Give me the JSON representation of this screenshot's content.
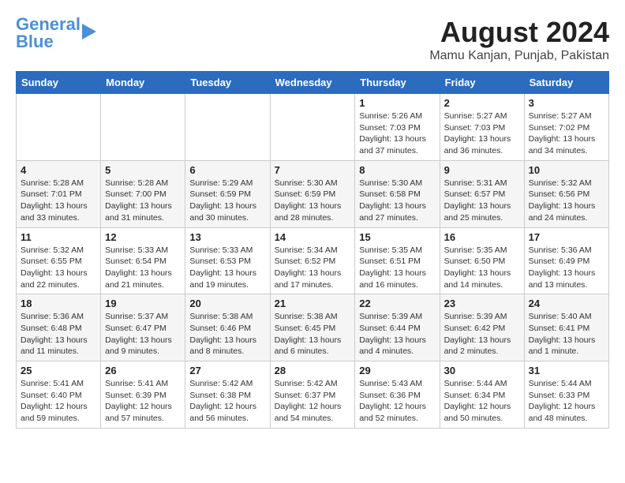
{
  "header": {
    "logo_general": "General",
    "logo_blue": "Blue",
    "month_year": "August 2024",
    "location": "Mamu Kanjan, Punjab, Pakistan"
  },
  "weekdays": [
    "Sunday",
    "Monday",
    "Tuesday",
    "Wednesday",
    "Thursday",
    "Friday",
    "Saturday"
  ],
  "weeks": [
    [
      {
        "day": "",
        "info": ""
      },
      {
        "day": "",
        "info": ""
      },
      {
        "day": "",
        "info": ""
      },
      {
        "day": "",
        "info": ""
      },
      {
        "day": "1",
        "info": "Sunrise: 5:26 AM\nSunset: 7:03 PM\nDaylight: 13 hours\nand 37 minutes."
      },
      {
        "day": "2",
        "info": "Sunrise: 5:27 AM\nSunset: 7:03 PM\nDaylight: 13 hours\nand 36 minutes."
      },
      {
        "day": "3",
        "info": "Sunrise: 5:27 AM\nSunset: 7:02 PM\nDaylight: 13 hours\nand 34 minutes."
      }
    ],
    [
      {
        "day": "4",
        "info": "Sunrise: 5:28 AM\nSunset: 7:01 PM\nDaylight: 13 hours\nand 33 minutes."
      },
      {
        "day": "5",
        "info": "Sunrise: 5:28 AM\nSunset: 7:00 PM\nDaylight: 13 hours\nand 31 minutes."
      },
      {
        "day": "6",
        "info": "Sunrise: 5:29 AM\nSunset: 6:59 PM\nDaylight: 13 hours\nand 30 minutes."
      },
      {
        "day": "7",
        "info": "Sunrise: 5:30 AM\nSunset: 6:59 PM\nDaylight: 13 hours\nand 28 minutes."
      },
      {
        "day": "8",
        "info": "Sunrise: 5:30 AM\nSunset: 6:58 PM\nDaylight: 13 hours\nand 27 minutes."
      },
      {
        "day": "9",
        "info": "Sunrise: 5:31 AM\nSunset: 6:57 PM\nDaylight: 13 hours\nand 25 minutes."
      },
      {
        "day": "10",
        "info": "Sunrise: 5:32 AM\nSunset: 6:56 PM\nDaylight: 13 hours\nand 24 minutes."
      }
    ],
    [
      {
        "day": "11",
        "info": "Sunrise: 5:32 AM\nSunset: 6:55 PM\nDaylight: 13 hours\nand 22 minutes."
      },
      {
        "day": "12",
        "info": "Sunrise: 5:33 AM\nSunset: 6:54 PM\nDaylight: 13 hours\nand 21 minutes."
      },
      {
        "day": "13",
        "info": "Sunrise: 5:33 AM\nSunset: 6:53 PM\nDaylight: 13 hours\nand 19 minutes."
      },
      {
        "day": "14",
        "info": "Sunrise: 5:34 AM\nSunset: 6:52 PM\nDaylight: 13 hours\nand 17 minutes."
      },
      {
        "day": "15",
        "info": "Sunrise: 5:35 AM\nSunset: 6:51 PM\nDaylight: 13 hours\nand 16 minutes."
      },
      {
        "day": "16",
        "info": "Sunrise: 5:35 AM\nSunset: 6:50 PM\nDaylight: 13 hours\nand 14 minutes."
      },
      {
        "day": "17",
        "info": "Sunrise: 5:36 AM\nSunset: 6:49 PM\nDaylight: 13 hours\nand 13 minutes."
      }
    ],
    [
      {
        "day": "18",
        "info": "Sunrise: 5:36 AM\nSunset: 6:48 PM\nDaylight: 13 hours\nand 11 minutes."
      },
      {
        "day": "19",
        "info": "Sunrise: 5:37 AM\nSunset: 6:47 PM\nDaylight: 13 hours\nand 9 minutes."
      },
      {
        "day": "20",
        "info": "Sunrise: 5:38 AM\nSunset: 6:46 PM\nDaylight: 13 hours\nand 8 minutes."
      },
      {
        "day": "21",
        "info": "Sunrise: 5:38 AM\nSunset: 6:45 PM\nDaylight: 13 hours\nand 6 minutes."
      },
      {
        "day": "22",
        "info": "Sunrise: 5:39 AM\nSunset: 6:44 PM\nDaylight: 13 hours\nand 4 minutes."
      },
      {
        "day": "23",
        "info": "Sunrise: 5:39 AM\nSunset: 6:42 PM\nDaylight: 13 hours\nand 2 minutes."
      },
      {
        "day": "24",
        "info": "Sunrise: 5:40 AM\nSunset: 6:41 PM\nDaylight: 13 hours\nand 1 minute."
      }
    ],
    [
      {
        "day": "25",
        "info": "Sunrise: 5:41 AM\nSunset: 6:40 PM\nDaylight: 12 hours\nand 59 minutes."
      },
      {
        "day": "26",
        "info": "Sunrise: 5:41 AM\nSunset: 6:39 PM\nDaylight: 12 hours\nand 57 minutes."
      },
      {
        "day": "27",
        "info": "Sunrise: 5:42 AM\nSunset: 6:38 PM\nDaylight: 12 hours\nand 56 minutes."
      },
      {
        "day": "28",
        "info": "Sunrise: 5:42 AM\nSunset: 6:37 PM\nDaylight: 12 hours\nand 54 minutes."
      },
      {
        "day": "29",
        "info": "Sunrise: 5:43 AM\nSunset: 6:36 PM\nDaylight: 12 hours\nand 52 minutes."
      },
      {
        "day": "30",
        "info": "Sunrise: 5:44 AM\nSunset: 6:34 PM\nDaylight: 12 hours\nand 50 minutes."
      },
      {
        "day": "31",
        "info": "Sunrise: 5:44 AM\nSunset: 6:33 PM\nDaylight: 12 hours\nand 48 minutes."
      }
    ]
  ]
}
